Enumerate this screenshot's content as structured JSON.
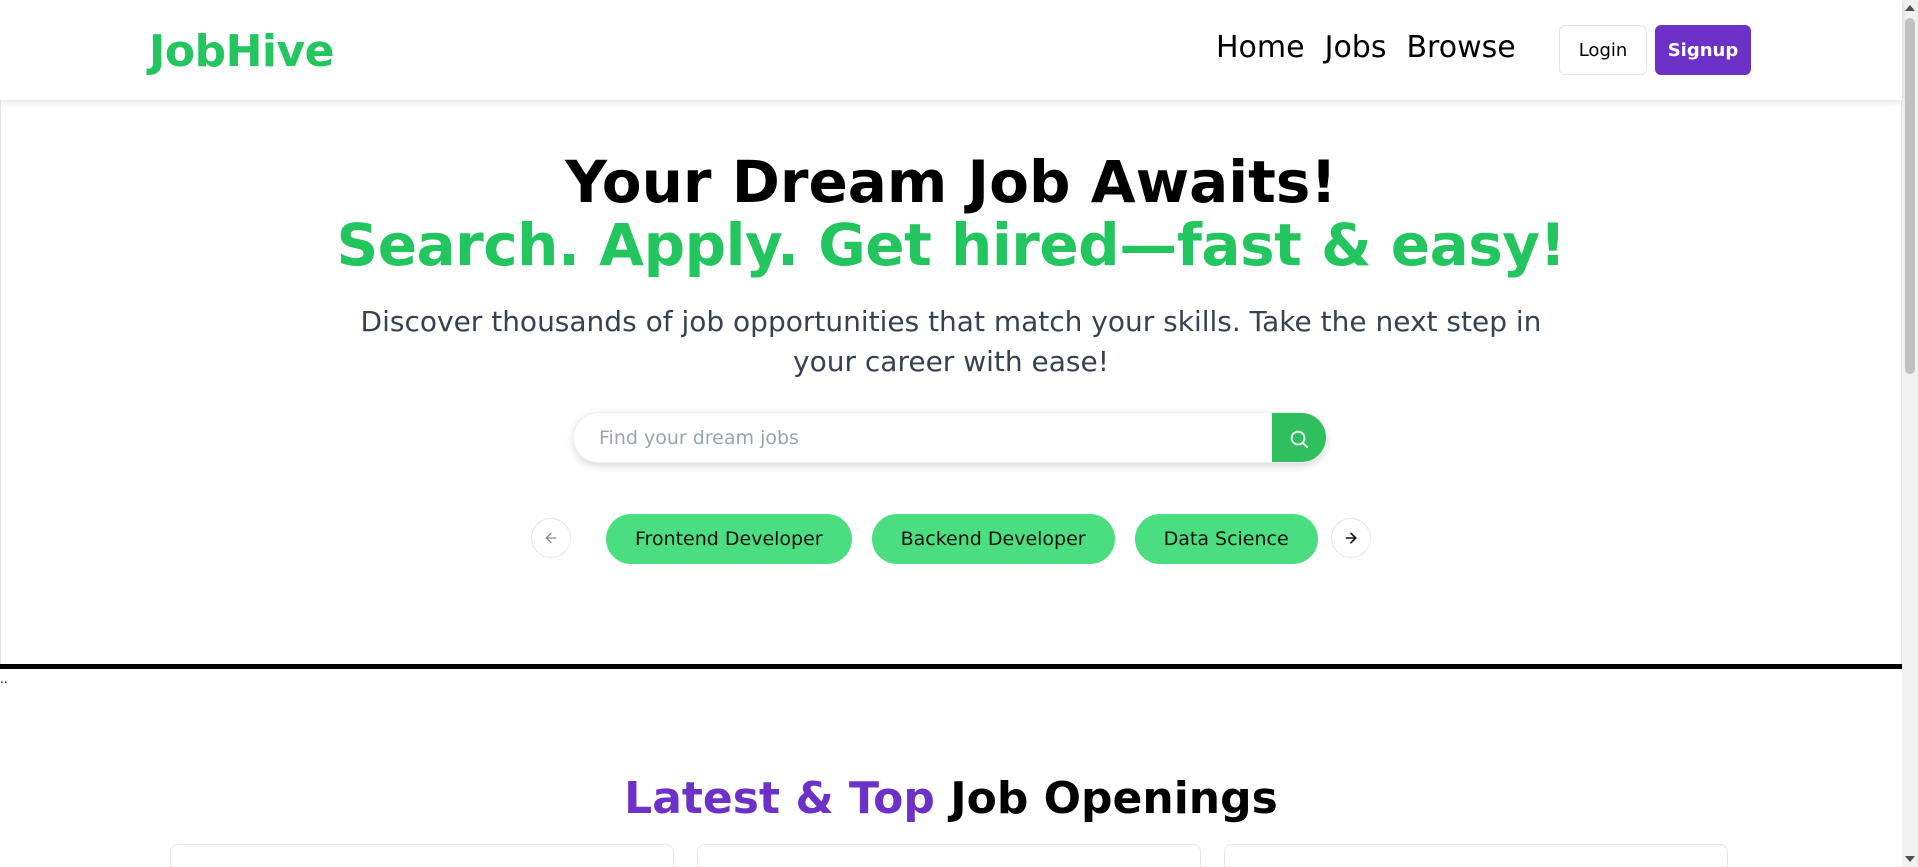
{
  "navbar": {
    "logo": "JobHive",
    "links": [
      {
        "label": "Home"
      },
      {
        "label": "Jobs"
      },
      {
        "label": "Browse"
      }
    ],
    "login_label": "Login",
    "signup_label": "Signup"
  },
  "hero": {
    "title": "Your Dream Job Awaits!",
    "subtitle": "Search. Apply. Get hired—fast & easy!",
    "description": "Discover thousands of job opportunities that match your skills. Take the next step in your career with ease!",
    "search": {
      "placeholder": "Find your dream jobs",
      "value": "",
      "button_icon": "search-icon"
    },
    "carousel": {
      "prev_icon": "arrow-left-icon",
      "next_icon": "arrow-right-icon",
      "categories": [
        "Frontend Developer",
        "Backend Developer",
        "Data Science"
      ]
    }
  },
  "divider_text": "..",
  "latest": {
    "heading_accent": "Latest & Top",
    "heading_rest": "Job Openings"
  },
  "colors": {
    "brand_green": "#22c55e",
    "chip_green": "#4ade80",
    "brand_purple": "#6d31c8"
  }
}
